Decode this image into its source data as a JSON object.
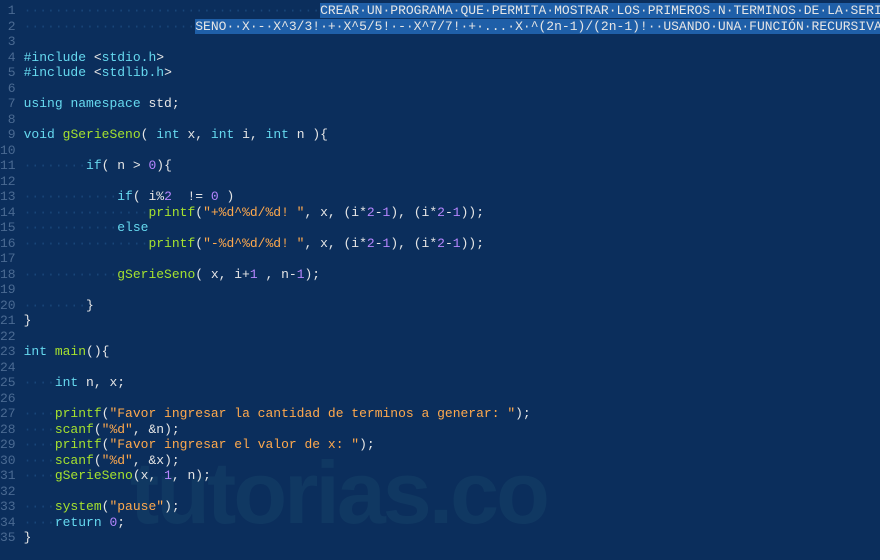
{
  "watermark": "tutorias.co",
  "colors": {
    "background": "#0b2e5c",
    "gutter": "#4a6a92",
    "text": "#e6e6e6",
    "selection": "#1f5fa8",
    "keyword": "#66d9ef",
    "string": "#ffa94d",
    "number": "#b686ff",
    "whitespace_dot": "#194679",
    "function": "#a6e22e",
    "watermark": "#103862"
  },
  "line_numbers": [
    "1",
    "2",
    "3",
    "4",
    "5",
    "6",
    "7",
    "8",
    "9",
    "10",
    "11",
    "12",
    "13",
    "14",
    "15",
    "16",
    "17",
    "18",
    "19",
    "20",
    "21",
    "22",
    "23",
    "24",
    "25",
    "26",
    "27",
    "28",
    "29",
    "30",
    "31",
    "32",
    "33",
    "34",
    "35"
  ],
  "lines": {
    "l1": {
      "selected": true,
      "pad": 38,
      "text": "CREAR UN PROGRAMA QUE PERMITA MOSTRAR LOS PRIMEROS N TERMINOS DE LA SERIE"
    },
    "l2": {
      "selected": true,
      "pad": 22,
      "text": "SENO  X - X^3/3! + X^5/5! - X^7/7! + ... X ^(2n-1)/(2n-1)!  USANDO UNA FUNCIÓN RECURSIVA"
    },
    "l3": {
      "text": ""
    },
    "l4": {
      "tokens": [
        [
          "inc",
          "#include"
        ],
        [
          "op",
          " <"
        ],
        [
          "type",
          "stdio.h"
        ],
        [
          "op",
          ">"
        ]
      ]
    },
    "l5": {
      "tokens": [
        [
          "inc",
          "#include"
        ],
        [
          "op",
          " <"
        ],
        [
          "type",
          "stdlib.h"
        ],
        [
          "op",
          ">"
        ]
      ]
    },
    "l6": {
      "text": ""
    },
    "l7": {
      "tokens": [
        [
          "kw",
          "using"
        ],
        [
          "op",
          " "
        ],
        [
          "kw",
          "namespace"
        ],
        [
          "op",
          " std;"
        ]
      ]
    },
    "l8": {
      "text": ""
    },
    "l9": {
      "tokens": [
        [
          "kw",
          "void"
        ],
        [
          "op",
          " "
        ],
        [
          "func",
          "gSerieSeno"
        ],
        [
          "op",
          "( "
        ],
        [
          "kw",
          "int"
        ],
        [
          "op",
          " x, "
        ],
        [
          "kw",
          "int"
        ],
        [
          "op",
          " i, "
        ],
        [
          "kw",
          "int"
        ],
        [
          "op",
          " n ){"
        ]
      ]
    },
    "l10": {
      "text": ""
    },
    "l11": {
      "indent": 2,
      "tokens": [
        [
          "kw",
          "if"
        ],
        [
          "op",
          "( n > "
        ],
        [
          "num",
          "0"
        ],
        [
          "op",
          "){"
        ]
      ]
    },
    "l12": {
      "text": ""
    },
    "l13": {
      "indent": 3,
      "tokens": [
        [
          "kw",
          "if"
        ],
        [
          "op",
          "( i%"
        ],
        [
          "num",
          "2"
        ],
        [
          "op",
          "  != "
        ],
        [
          "num",
          "0"
        ],
        [
          "op",
          " )"
        ]
      ]
    },
    "l14": {
      "indent": 4,
      "tokens": [
        [
          "func",
          "printf"
        ],
        [
          "op",
          "("
        ],
        [
          "str",
          "\"+%d^%d/%d! \""
        ],
        [
          "op",
          ", x, (i*"
        ],
        [
          "num",
          "2"
        ],
        [
          "op",
          "-"
        ],
        [
          "num",
          "1"
        ],
        [
          "op",
          "), (i*"
        ],
        [
          "num",
          "2"
        ],
        [
          "op",
          "-"
        ],
        [
          "num",
          "1"
        ],
        [
          "op",
          "));"
        ]
      ]
    },
    "l15": {
      "indent": 3,
      "tokens": [
        [
          "kw",
          "else"
        ]
      ]
    },
    "l16": {
      "indent": 4,
      "tokens": [
        [
          "func",
          "printf"
        ],
        [
          "op",
          "("
        ],
        [
          "str",
          "\"-%d^%d/%d! \""
        ],
        [
          "op",
          ", x, (i*"
        ],
        [
          "num",
          "2"
        ],
        [
          "op",
          "-"
        ],
        [
          "num",
          "1"
        ],
        [
          "op",
          "), (i*"
        ],
        [
          "num",
          "2"
        ],
        [
          "op",
          "-"
        ],
        [
          "num",
          "1"
        ],
        [
          "op",
          "));"
        ]
      ]
    },
    "l17": {
      "text": ""
    },
    "l18": {
      "indent": 3,
      "tokens": [
        [
          "func",
          "gSerieSeno"
        ],
        [
          "op",
          "( x, i+"
        ],
        [
          "num",
          "1"
        ],
        [
          "op",
          " , n-"
        ],
        [
          "num",
          "1"
        ],
        [
          "op",
          ");"
        ]
      ]
    },
    "l19": {
      "text": ""
    },
    "l20": {
      "indent": 2,
      "tokens": [
        [
          "op",
          "}"
        ]
      ]
    },
    "l21": {
      "tokens": [
        [
          "op",
          "}"
        ]
      ]
    },
    "l22": {
      "text": ""
    },
    "l23": {
      "tokens": [
        [
          "kw",
          "int"
        ],
        [
          "op",
          " "
        ],
        [
          "func",
          "main"
        ],
        [
          "op",
          "(){"
        ]
      ]
    },
    "l24": {
      "text": ""
    },
    "l25": {
      "indent": 1,
      "tokens": [
        [
          "kw",
          "int"
        ],
        [
          "op",
          " n, x;"
        ]
      ]
    },
    "l26": {
      "text": ""
    },
    "l27": {
      "indent": 1,
      "tokens": [
        [
          "func",
          "printf"
        ],
        [
          "op",
          "("
        ],
        [
          "str",
          "\"Favor ingresar la cantidad de terminos a generar: \""
        ],
        [
          "op",
          ");"
        ]
      ]
    },
    "l28": {
      "indent": 1,
      "tokens": [
        [
          "func",
          "scanf"
        ],
        [
          "op",
          "("
        ],
        [
          "str",
          "\"%d\""
        ],
        [
          "op",
          ", &n);"
        ]
      ]
    },
    "l29": {
      "indent": 1,
      "tokens": [
        [
          "func",
          "printf"
        ],
        [
          "op",
          "("
        ],
        [
          "str",
          "\"Favor ingresar el valor de x: \""
        ],
        [
          "op",
          ");"
        ]
      ]
    },
    "l30": {
      "indent": 1,
      "tokens": [
        [
          "func",
          "scanf"
        ],
        [
          "op",
          "("
        ],
        [
          "str",
          "\"%d\""
        ],
        [
          "op",
          ", &x);"
        ]
      ]
    },
    "l31": {
      "indent": 1,
      "tokens": [
        [
          "func",
          "gSerieSeno"
        ],
        [
          "op",
          "(x, "
        ],
        [
          "num",
          "1"
        ],
        [
          "op",
          ", n);"
        ]
      ]
    },
    "l32": {
      "text": ""
    },
    "l33": {
      "indent": 1,
      "tokens": [
        [
          "func",
          "system"
        ],
        [
          "op",
          "("
        ],
        [
          "str",
          "\"pause\""
        ],
        [
          "op",
          ");"
        ]
      ]
    },
    "l34": {
      "indent": 1,
      "tokens": [
        [
          "kw",
          "return"
        ],
        [
          "op",
          " "
        ],
        [
          "num",
          "0"
        ],
        [
          "op",
          ";"
        ]
      ]
    },
    "l35": {
      "tokens": [
        [
          "op",
          "}"
        ]
      ]
    }
  }
}
